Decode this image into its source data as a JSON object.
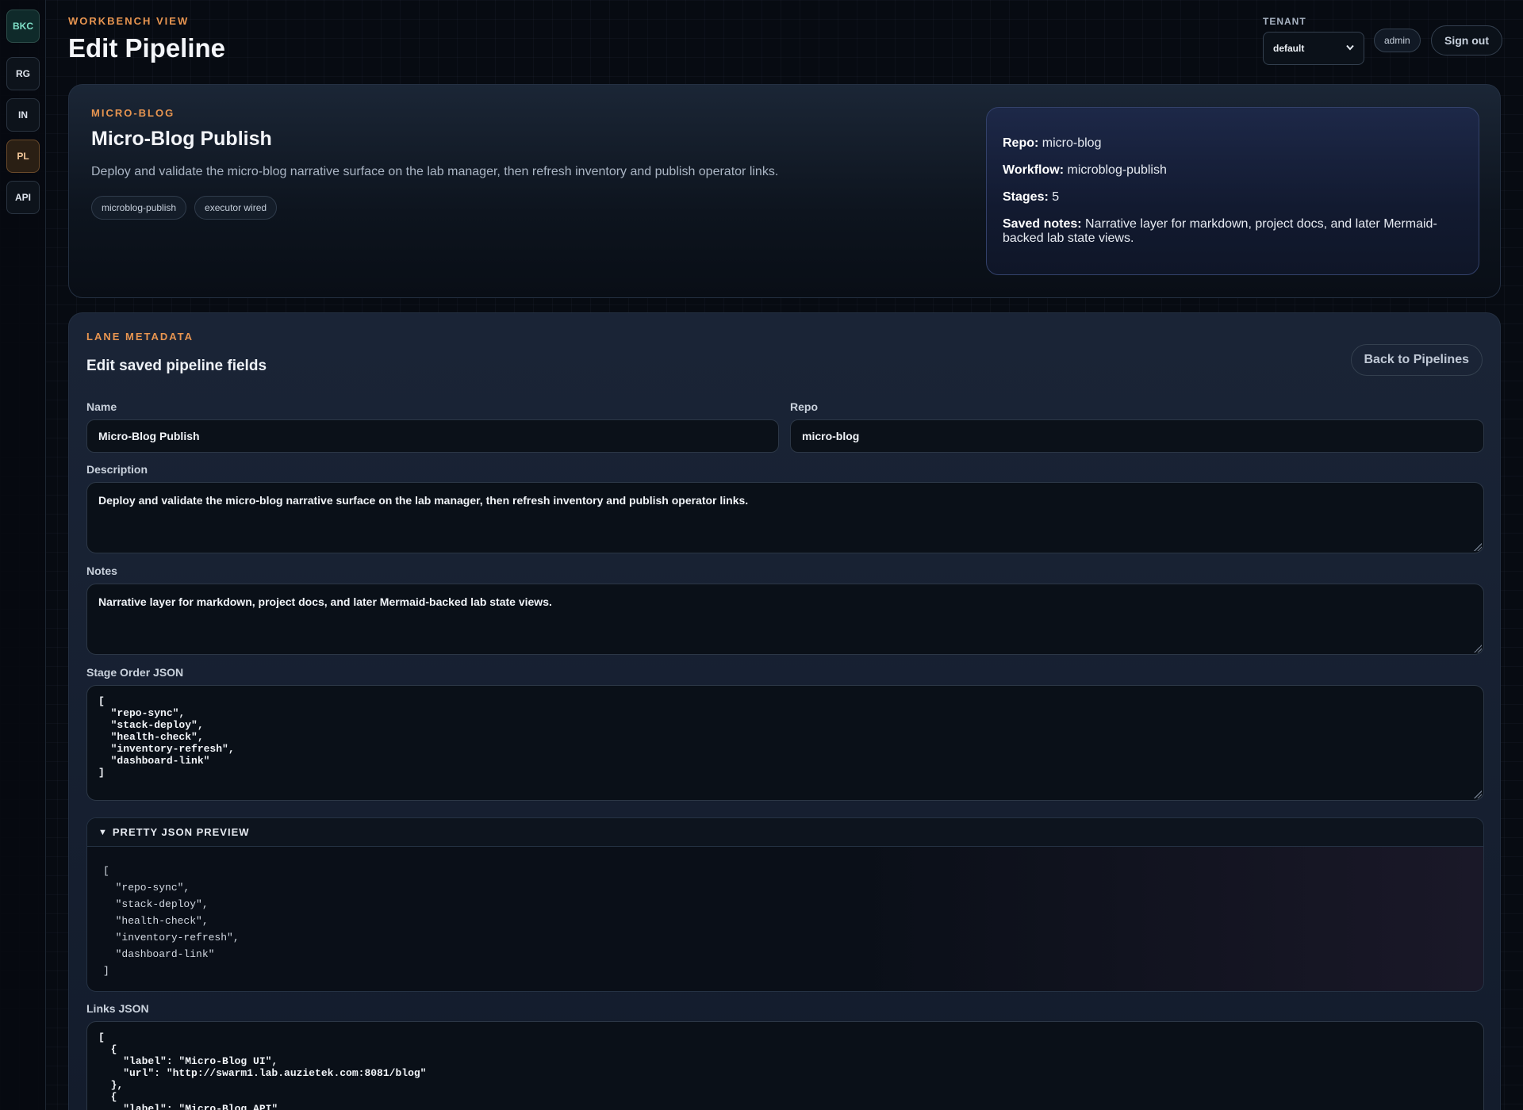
{
  "sidebar": {
    "items": [
      {
        "label": "BKC"
      },
      {
        "label": "RG"
      },
      {
        "label": "IN"
      },
      {
        "label": "PL"
      },
      {
        "label": "API"
      }
    ]
  },
  "header": {
    "eyebrow": "WORKBENCH VIEW",
    "title": "Edit Pipeline",
    "tenant_label": "TENANT",
    "tenant_value": "default",
    "user": "admin",
    "signout_label": "Sign out"
  },
  "hero": {
    "eyebrow": "MICRO-BLOG",
    "title": "Micro-Blog Publish",
    "description": "Deploy and validate the micro-blog narrative surface on the lab manager, then refresh inventory and publish operator links.",
    "tags": [
      "microblog-publish",
      "executor wired"
    ],
    "summary": {
      "repo_label": "Repo:",
      "repo_value": "micro-blog",
      "workflow_label": "Workflow:",
      "workflow_value": "microblog-publish",
      "stages_label": "Stages:",
      "stages_value": "5",
      "notes_label": "Saved notes:",
      "notes_value": "Narrative layer for markdown, project docs, and later Mermaid-backed lab state views."
    }
  },
  "form": {
    "eyebrow": "LANE METADATA",
    "title": "Edit saved pipeline fields",
    "back_label": "Back to Pipelines",
    "name_label": "Name",
    "name_value": "Micro-Blog Publish",
    "repo_label": "Repo",
    "repo_value": "micro-blog",
    "description_label": "Description",
    "description_value": "Deploy and validate the micro-blog narrative surface on the lab manager, then refresh inventory and publish operator links.",
    "notes_label": "Notes",
    "notes_value": "Narrative layer for markdown, project docs, and later Mermaid-backed lab state views.",
    "stage_order_label": "Stage Order JSON",
    "stage_order_value": "[\n  \"repo-sync\",\n  \"stack-deploy\",\n  \"health-check\",\n  \"inventory-refresh\",\n  \"dashboard-link\"\n]",
    "preview_label": "PRETTY JSON PREVIEW",
    "preview_value": "[\n  \"repo-sync\",\n  \"stack-deploy\",\n  \"health-check\",\n  \"inventory-refresh\",\n  \"dashboard-link\"\n]",
    "links_label": "Links JSON",
    "links_value": "[\n  {\n    \"label\": \"Micro-Blog UI\",\n    \"url\": \"http://swarm1.lab.auzietek.com:8081/blog\"\n  },\n  {\n    \"label\": \"Micro-Blog API\","
  }
}
